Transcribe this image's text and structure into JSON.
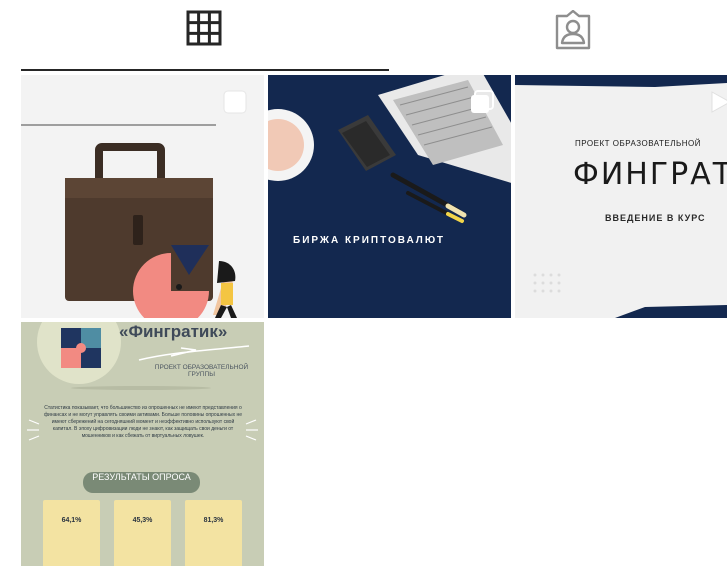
{
  "tabs": [
    {
      "icon": "grid-icon",
      "selected": true
    },
    {
      "icon": "tagged-person-icon",
      "selected": false
    }
  ],
  "posts": [
    {
      "icon": "multi-image-icon"
    },
    {
      "caption": "БИРЖА КРИПТОВАЛЮТ",
      "icon": "multi-image-icon"
    },
    {
      "line1": "ПРОЕКТ ОБРАЗОВАТЕЛЬНОЙ",
      "line2": "ФИНГРАТИ",
      "line3": "ВВЕДЕНИЕ В КУРС",
      "icon": "video-icon"
    },
    {
      "title": "«Фингратик»",
      "subtitle": "ПРОЕКТ ОБРАЗОВАТЕЛЬНОЙ ГРУППЫ",
      "paragraph": "Статистика показывает, что большинство из опрошенных не имеют представления о финансах и не могут управлять своими активами. Больше половины опрошенных не имеют сбережений на сегодняшний момент и неэффективно используют свой капитал. В эпоху цифровизации люди не знают, как защищать свои деньги от мошенников и как сбежать от виртуальных ловушек.",
      "results_label": "РЕЗУЛЬТАТЫ ОПРОСА",
      "stats": [
        "64,1%",
        "45,3%",
        "81,3%"
      ]
    }
  ],
  "colors": {
    "navy": "#13284f",
    "underline": "#262626",
    "sage": "#c8cdb5",
    "card": "#f3e3a2"
  }
}
